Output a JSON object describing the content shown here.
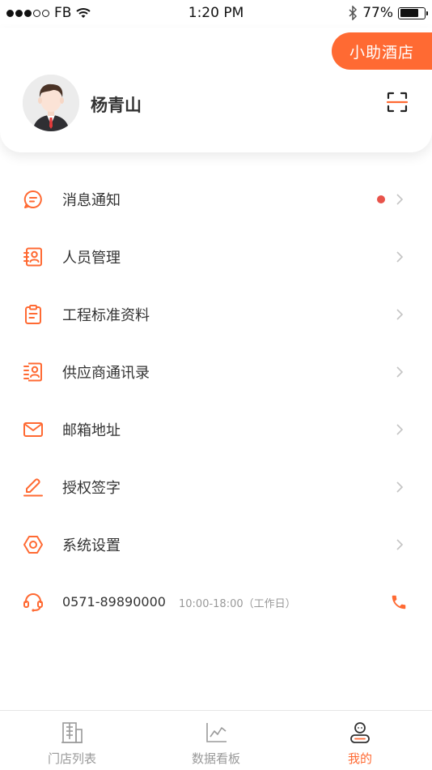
{
  "status_bar": {
    "carrier": "FB",
    "time": "1:20 PM",
    "battery": "77%",
    "battery_level": 0.77
  },
  "profile": {
    "hotel_button": "小助酒店",
    "name": "杨青山"
  },
  "menu": {
    "items": [
      {
        "label": "消息通知",
        "icon": "message-icon",
        "unread": true
      },
      {
        "label": "人员管理",
        "icon": "contact-card-icon"
      },
      {
        "label": "工程标准资料",
        "icon": "clipboard-icon"
      },
      {
        "label": "供应商通讯录",
        "icon": "address-book-icon"
      },
      {
        "label": "邮箱地址",
        "icon": "mail-icon"
      },
      {
        "label": "授权签字",
        "icon": "pen-icon"
      },
      {
        "label": "系统设置",
        "icon": "hexagon-settings-icon"
      }
    ],
    "service": {
      "phone": "0571-89890000",
      "hours": "10:00-18:00（工作日）"
    }
  },
  "tabs": [
    {
      "label": "门店列表",
      "icon": "building-icon",
      "active": false
    },
    {
      "label": "数据看板",
      "icon": "chart-icon",
      "active": false
    },
    {
      "label": "我的",
      "icon": "profile-icon",
      "active": true
    }
  ],
  "colors": {
    "accent": "#ff6a33",
    "badge": "#e8534a",
    "text": "#333333",
    "muted": "#999999"
  }
}
